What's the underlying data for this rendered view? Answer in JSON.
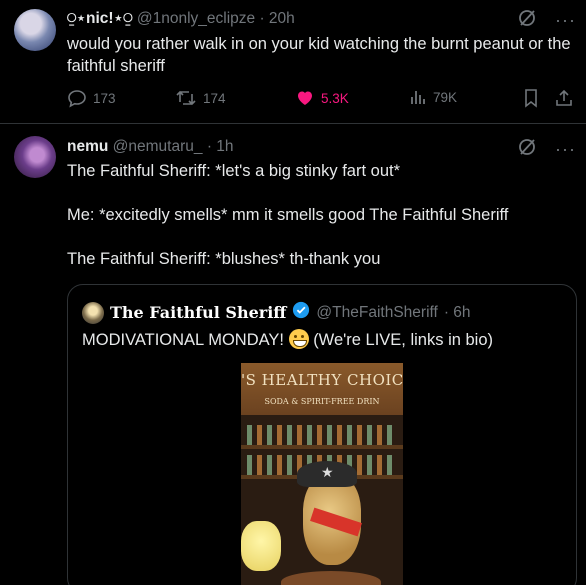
{
  "tweet1": {
    "display_name": "⍜⋆nic!⋆⍜",
    "handle": "@1nonly_eclipze",
    "time": "· 20h",
    "text": "would you rather walk in on your kid watching the burnt peanut or the faithful sheriff",
    "stats": {
      "replies": "173",
      "reposts": "174",
      "likes": "5.3K",
      "views": "79K"
    }
  },
  "tweet2": {
    "display_name": "nemu",
    "handle": "@nemutaru_",
    "time": "· 1h",
    "lines": [
      "The Faithful Sheriff: *let's a big stinky fart out*",
      "Me: *excitedly smells* mm it smells good The Faithful Sheriff",
      "The Faithful Sheriff: *blushes* th-thank you"
    ]
  },
  "quote": {
    "display_name": "The Faithful Sheriff",
    "handle": "@TheFaithSheriff",
    "time": "· 6h",
    "text_before": "MODIVATIONAL MONDAY!",
    "text_after": "(We're LIVE, links in bio)",
    "video_sign": "'S HEALTHY CHOIC",
    "video_subsign": "SODA & SPIRIT-FREE DRIN"
  },
  "colors": {
    "like": "#f91880",
    "muted": "#71767b",
    "verified": "#1d9bf0"
  },
  "icons": [
    "grok-icon",
    "more-icon",
    "reply-icon",
    "repost-icon",
    "like-icon",
    "views-icon",
    "bookmark-icon",
    "share-icon",
    "verified-icon"
  ]
}
